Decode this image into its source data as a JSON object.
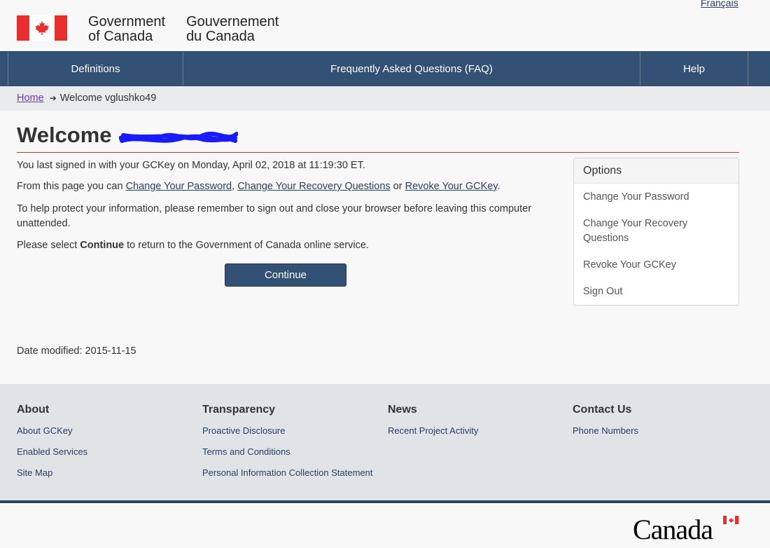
{
  "header": {
    "language_link": "Français",
    "signature_en_line1": "Government",
    "signature_en_line2": "of Canada",
    "signature_fr_line1": "Gouvernement",
    "signature_fr_line2": "du Canada"
  },
  "nav": {
    "items": [
      {
        "label": "Definitions"
      },
      {
        "label": "Frequently Asked Questions (FAQ)"
      },
      {
        "label": "Help"
      }
    ]
  },
  "breadcrumb": {
    "home": "Home",
    "current": "Welcome vglushko49"
  },
  "main": {
    "title": "Welcome",
    "last_signed": "You last signed in with your GCKey on Monday, April 02, 2018 at 11:19:30 ET.",
    "from_page_prefix": "From this page you can ",
    "link_change_password": "Change Your Password",
    "sep_comma": ", ",
    "link_change_recovery": "Change Your Recovery Questions",
    "sep_or": " or ",
    "link_revoke": "Revoke Your GCKey",
    "period": ".",
    "protect_info": "To help protect your information, please remember to sign out and close your browser before leaving this computer unattended.",
    "select_prefix": "Please select ",
    "select_bold": "Continue",
    "select_suffix": " to return to the Government of Canada online service.",
    "continue_button": "Continue",
    "date_modified": "Date modified: 2015-11-15"
  },
  "options": {
    "heading": "Options",
    "items": [
      {
        "label": "Change Your Password"
      },
      {
        "label": "Change Your Recovery Questions"
      },
      {
        "label": "Revoke Your GCKey"
      },
      {
        "label": "Sign Out"
      }
    ]
  },
  "footer": {
    "columns": [
      {
        "heading": "About",
        "links": [
          "About GCKey",
          "Enabled Services",
          "Site Map"
        ]
      },
      {
        "heading": "Transparency",
        "links": [
          "Proactive Disclosure",
          "Terms and Conditions",
          "Personal Information Collection Statement"
        ]
      },
      {
        "heading": "News",
        "links": [
          "Recent Project Activity"
        ]
      },
      {
        "heading": "Contact Us",
        "links": [
          "Phone Numbers"
        ]
      }
    ],
    "wordmark": "Canada"
  },
  "colors": {
    "nav_bg": "#335075",
    "flag_red": "#ea2d2d",
    "title_rule": "#af3c43",
    "redaction": "#1a1aff"
  }
}
